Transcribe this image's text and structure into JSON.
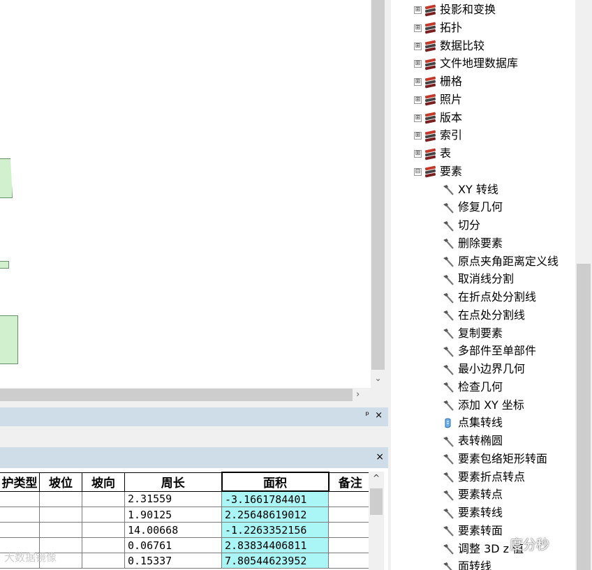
{
  "tree": {
    "items": [
      {
        "label": "投影和变换",
        "type": "toolbox",
        "expander": "⊞"
      },
      {
        "label": "拓扑",
        "type": "toolbox",
        "expander": "⊞"
      },
      {
        "label": "数据比较",
        "type": "toolbox",
        "expander": "⊞"
      },
      {
        "label": "文件地理数据库",
        "type": "toolbox",
        "expander": "⊞"
      },
      {
        "label": "栅格",
        "type": "toolbox",
        "expander": "⊞"
      },
      {
        "label": "照片",
        "type": "toolbox",
        "expander": "⊞"
      },
      {
        "label": "版本",
        "type": "toolbox",
        "expander": "⊞"
      },
      {
        "label": "索引",
        "type": "toolbox",
        "expander": "⊞"
      },
      {
        "label": "表",
        "type": "toolbox",
        "expander": "⊞"
      },
      {
        "label": "要素",
        "type": "toolbox",
        "expander": "⊟"
      },
      {
        "label": "XY 转线",
        "type": "tool"
      },
      {
        "label": "修复几何",
        "type": "tool"
      },
      {
        "label": "切分",
        "type": "tool"
      },
      {
        "label": "删除要素",
        "type": "tool"
      },
      {
        "label": "原点夹角距离定义线",
        "type": "tool"
      },
      {
        "label": "取消线分割",
        "type": "tool"
      },
      {
        "label": "在折点处分割线",
        "type": "tool"
      },
      {
        "label": "在点处分割线",
        "type": "tool"
      },
      {
        "label": "复制要素",
        "type": "tool"
      },
      {
        "label": "多部件至单部件",
        "type": "tool"
      },
      {
        "label": "最小边界几何",
        "type": "tool"
      },
      {
        "label": "检查几何",
        "type": "tool"
      },
      {
        "label": "添加 XY 坐标",
        "type": "tool"
      },
      {
        "label": "点集转线",
        "type": "script"
      },
      {
        "label": "表转椭圆",
        "type": "tool"
      },
      {
        "label": "要素包络矩形转面",
        "type": "tool"
      },
      {
        "label": "要素折点转点",
        "type": "tool"
      },
      {
        "label": "要素转点",
        "type": "tool"
      },
      {
        "label": "要素转线",
        "type": "tool"
      },
      {
        "label": "要素转面",
        "type": "tool"
      },
      {
        "label": "调整 3D z 值",
        "type": "tool"
      },
      {
        "label": "面转线",
        "type": "tool"
      }
    ]
  },
  "panel": {
    "pin_close": "ᵖ ×",
    "close": "×"
  },
  "table": {
    "columns": [
      "护类型",
      "坡位",
      "坡向",
      "周长",
      "面积",
      "备注"
    ],
    "rows": [
      [
        "",
        "",
        "",
        "2.31559",
        "-3.1661784401",
        ""
      ],
      [
        "",
        "",
        "",
        "1.90125",
        "2.25648619012",
        ""
      ],
      [
        "",
        "",
        "",
        "14.00668",
        "-1.2263352156",
        ""
      ],
      [
        "",
        "",
        "",
        "0.06761",
        "2.83834406811",
        ""
      ],
      [
        "",
        "",
        "",
        "0.15337",
        "7.80544623952",
        ""
      ]
    ]
  },
  "scroll": {
    "down_arrow": "⌄",
    "right_arrow": "›",
    "up_arrow": "^"
  },
  "watermark": {
    "left": "大数据镜像",
    "right": "度分秒"
  }
}
